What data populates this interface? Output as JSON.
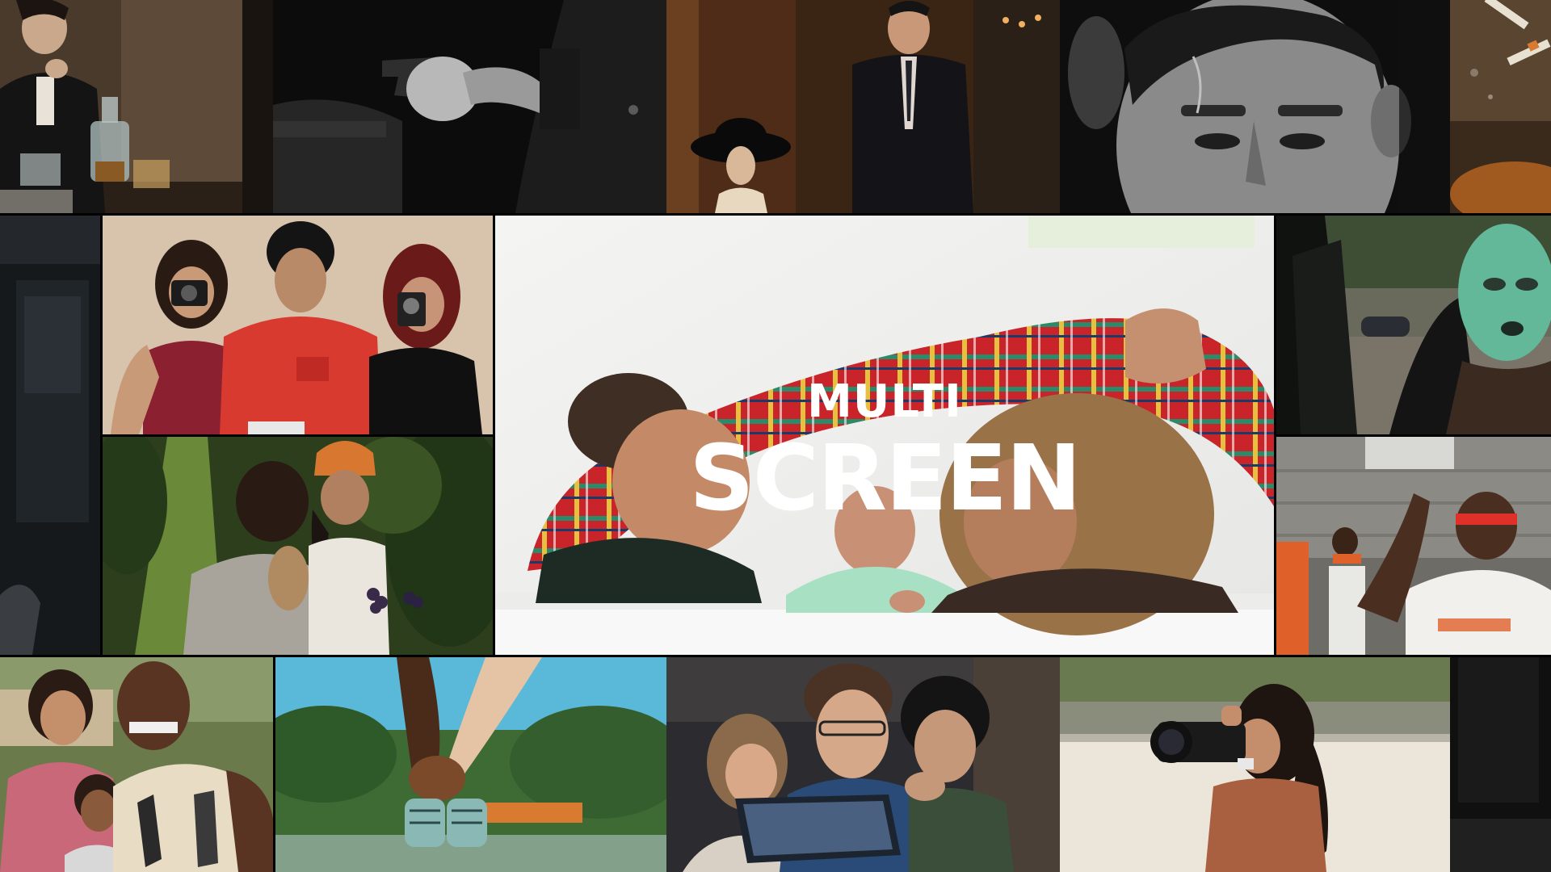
{
  "title": {
    "line1": "MULTI",
    "line2": "SCREEN"
  },
  "colors": {
    "background": "#000000",
    "title_text": "#ffffff"
  },
  "tiles": [
    {
      "name": "bw-man-smoking-tile"
    },
    {
      "name": "noir-revolver-hand-tile"
    },
    {
      "name": "suited-couple-hat-tile"
    },
    {
      "name": "bw-scarred-face-tile"
    },
    {
      "name": "ashtray-cigarettes-tile"
    },
    {
      "name": "dark-interior-left-tile"
    },
    {
      "name": "three-people-cameras-tile"
    },
    {
      "name": "women-grapes-tile"
    },
    {
      "name": "family-blanket-feature-tile"
    },
    {
      "name": "green-ski-mask-tile"
    },
    {
      "name": "street-crowd-orange-tile"
    },
    {
      "name": "family-selfie-tile"
    },
    {
      "name": "hands-baby-shoes-tile"
    },
    {
      "name": "family-tablet-tile"
    },
    {
      "name": "woman-photographer-tile"
    },
    {
      "name": "dark-edge-right-tile"
    }
  ]
}
